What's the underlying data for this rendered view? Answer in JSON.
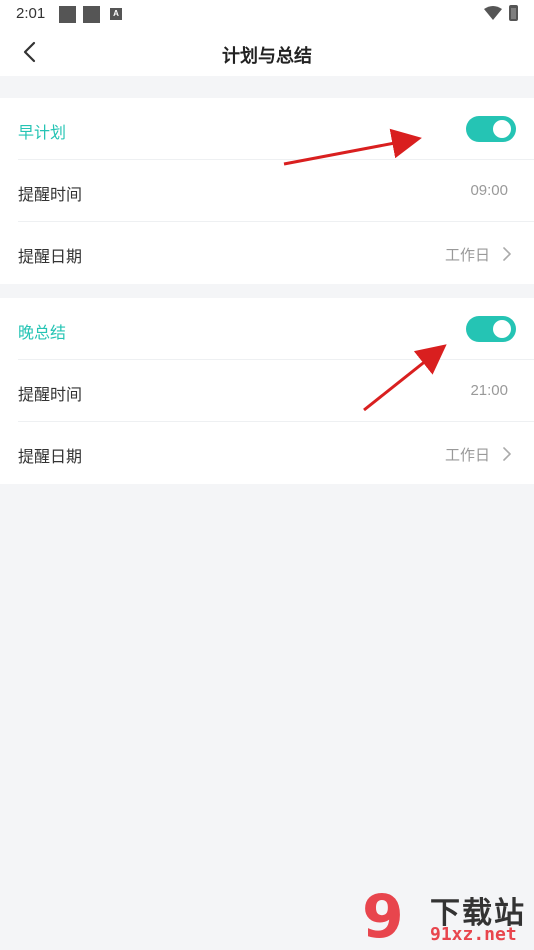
{
  "status_bar": {
    "time": "2:01",
    "indicator_a": "A"
  },
  "header": {
    "title": "计划与总结"
  },
  "morning": {
    "label": "早计划",
    "toggle_on": true,
    "reminder_time_label": "提醒时间",
    "reminder_time_value": "09:00",
    "reminder_date_label": "提醒日期",
    "reminder_date_value": "工作日"
  },
  "evening": {
    "label": "晚总结",
    "toggle_on": true,
    "reminder_time_label": "提醒时间",
    "reminder_time_value": "21:00",
    "reminder_date_label": "提醒日期",
    "reminder_date_value": "工作日"
  },
  "watermark": {
    "brand_cn": "下载站",
    "url": "91xz.net",
    "logo": "9"
  },
  "colors": {
    "accent": "#25c4b4",
    "arrow": "#d91f1f",
    "background": "#f4f5f7"
  },
  "icons": [
    "back-icon",
    "chevron-right-icon",
    "wifi-icon",
    "battery-icon"
  ]
}
